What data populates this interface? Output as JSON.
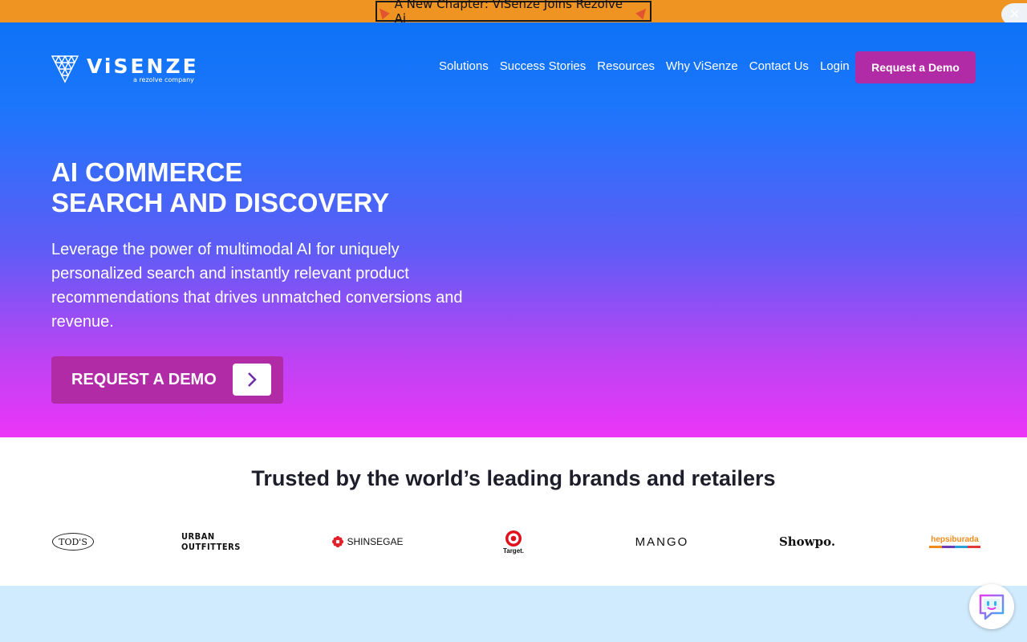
{
  "announcement": {
    "text": "A New Chapter: ViSenze Joins Rezolve Ai",
    "close_label": "✕"
  },
  "header": {
    "logo_text": "ViSENZE",
    "logo_sub": "a rezolve company",
    "nav": [
      "Solutions",
      "Success Stories",
      "Resources",
      "Why ViSenze",
      "Contact Us",
      "Login"
    ],
    "cta_label": "Request a Demo"
  },
  "hero": {
    "title_line1": "AI COMMERCE",
    "title_line2": "SEARCH AND DISCOVERY",
    "text": "Leverage the power of multimodal AI for uniquely personalized search and instantly relevant product recommendations that drives unmatched conversions and revenue.",
    "cta_label": "REQUEST A DEMO"
  },
  "trusted": {
    "title": "Trusted by the world’s leading brands and retailers",
    "brands": {
      "tods": "TOD'S",
      "urban": "URBAN OUTFITTERS",
      "shinsegae": "SHINSEGAE",
      "target": "Target.",
      "mango": "MANGO",
      "showpo": "Showpo.",
      "hepsiburada": "hepsiburada"
    }
  },
  "colors": {
    "announce_bg": "#ef9323",
    "hero_top": "#0d72f7",
    "hero_bottom": "#ec35f6",
    "accent": "#b12ba6",
    "band": "#d0ebfd"
  }
}
